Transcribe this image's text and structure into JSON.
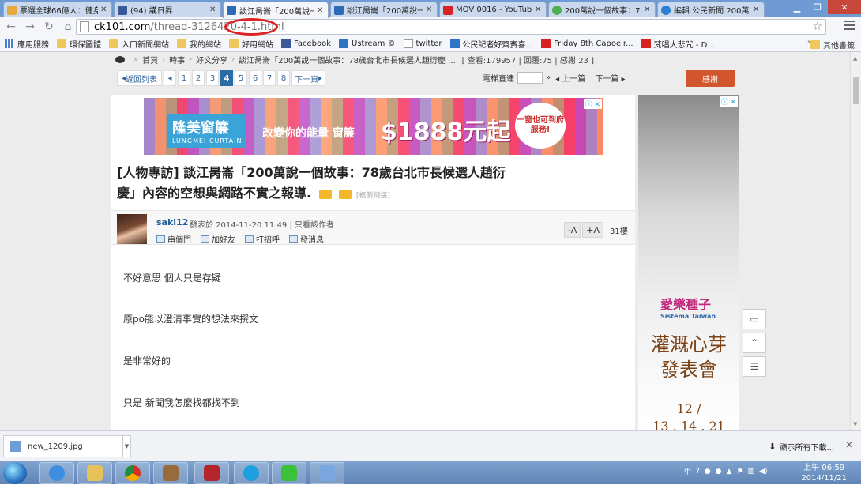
{
  "browser": {
    "tabs": [
      {
        "title": "票選全球66億人：健身",
        "color": "#e6a93a"
      },
      {
        "title": "(94) 講日昇",
        "color": "#3b5998"
      },
      {
        "title": "談江昺崙「200萬說一",
        "color": "#2d6ab5"
      },
      {
        "title": "談江昺崙「200萬說一",
        "color": "#2d6ab5"
      },
      {
        "title": "MOV 0016 - YouTub",
        "color": "#d62222"
      },
      {
        "title": "200萬說一個故事：78",
        "color": "#4caf50"
      },
      {
        "title": "編輯 公民新聞 200萬說",
        "color": "#2c7fd1"
      }
    ],
    "url_host": "ck101.com",
    "url_path": "/thread-3126420-4-1.html",
    "bookmarks": [
      {
        "label": "應用服務",
        "kind": "apps"
      },
      {
        "label": "環保圖體",
        "kind": "folder"
      },
      {
        "label": "入口新聞網站",
        "kind": "folder"
      },
      {
        "label": "我的網站",
        "kind": "folder"
      },
      {
        "label": "好用網站",
        "kind": "folder"
      },
      {
        "label": "Facebook",
        "kind": "facebook"
      },
      {
        "label": "Ustream ©",
        "kind": "ustream"
      },
      {
        "label": "twitter",
        "kind": "page"
      },
      {
        "label": "公民記者好齊賓喜...",
        "kind": "ustream"
      },
      {
        "label": "Friday 8th Capoeir...",
        "kind": "youtube"
      },
      {
        "label": "梵唱大悲咒 - D...",
        "kind": "youtube"
      }
    ],
    "bookmarks_more": "»",
    "bookmarks_other": "其他書籤"
  },
  "page": {
    "breadcrumb": [
      "首頁",
      "時事",
      "好文分享",
      "談江昺崙「200萬說一個故事：78歲台北市長候選人趙衍慶 ..."
    ],
    "stats": "[ 查看:179957 | 回覆:75 | 感謝:23 ]",
    "pager": {
      "back": "返回列表",
      "pages": [
        "1",
        "2",
        "3",
        "4",
        "5",
        "6",
        "7",
        "8"
      ],
      "current": "4",
      "next": "下一頁"
    },
    "floor_jump": "電梯直達",
    "prev_thread": "上一篇",
    "next_thread": "下一篇",
    "thanks_button": "感謝",
    "banner_ad": {
      "brand": "隆美窗簾",
      "brand_en": "LUNGMEI CURTAIN",
      "slogan": "改變你的能量 窗簾",
      "price": "$1888元起",
      "badge": "一窗也可到府服務!",
      "ad_mark": "ⓘ ✕"
    },
    "title": "[人物專訪] 談江昺崙「200萬說一個故事：78歲台北市長候選人趙衍慶」內容的空想與網路不實之報導.",
    "title_copy": "[複製鏈接]",
    "author": {
      "name": "saki12",
      "meta": "發表於 2014-11-20 11:49 | 只看該作者",
      "actions": [
        "串個門",
        "加好友",
        "打招呼",
        "發消息"
      ],
      "font_minus": "-A",
      "font_plus": "+A",
      "floor": "31樓"
    },
    "post_lines": [
      "不好意思 個人只是存疑",
      "原po能以澄清事實的想法來撰文",
      "是非常好的",
      "只是 新聞我怎麼找都找不到"
    ],
    "side_ad": {
      "ad_mark": "ⓘ ✕",
      "brand": "愛樂種子",
      "brand_sub": "Sistema Taiwan",
      "headline_1": "灌溉心芽",
      "headline_2": "發表會",
      "date_1": "12 /",
      "date_2": "13 . 14 . 21"
    }
  },
  "downloads": {
    "file": "new_1209.jpg",
    "show_all": "顯示所有下載..."
  },
  "taskbar": {
    "time": "上午 06:59",
    "date": "2014/11/21",
    "tray_lang": "中"
  }
}
